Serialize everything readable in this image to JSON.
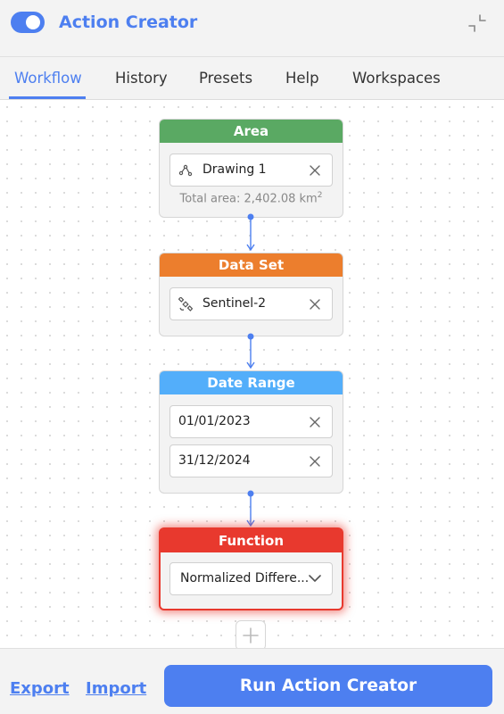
{
  "header": {
    "title": "Action Creator",
    "toggle_on": true,
    "toggle_icon": "toggle-switch-icon",
    "collapse_icon": "collapse-icon"
  },
  "tabs": [
    {
      "label": "Workflow",
      "active": true
    },
    {
      "label": "History",
      "active": false
    },
    {
      "label": "Presets",
      "active": false
    },
    {
      "label": "Help",
      "active": false
    },
    {
      "label": "Workspaces",
      "active": false
    }
  ],
  "nodes": {
    "area": {
      "title": "Area",
      "color": "#5aa963",
      "field": {
        "value": "Drawing 1",
        "icon": "drawing-icon"
      },
      "total_label": "Total area: 2,402.08 km",
      "total_sup": "2"
    },
    "dataset": {
      "title": "Data Set",
      "color": "#ec7e2d",
      "field": {
        "value": "Sentinel-2",
        "icon": "satellite-icon"
      }
    },
    "daterange": {
      "title": "Date Range",
      "color": "#53aefa",
      "start": "01/01/2023",
      "end": "31/12/2024"
    },
    "function": {
      "title": "Function",
      "color": "#e8392e",
      "selected": "Normalized Differe...",
      "highlighted": true
    }
  },
  "footer": {
    "export_label": "Export",
    "import_label": "Import",
    "run_label": "Run Action Creator"
  },
  "colors": {
    "accent": "#4d7ff0",
    "panel": "#f3f3f3"
  }
}
